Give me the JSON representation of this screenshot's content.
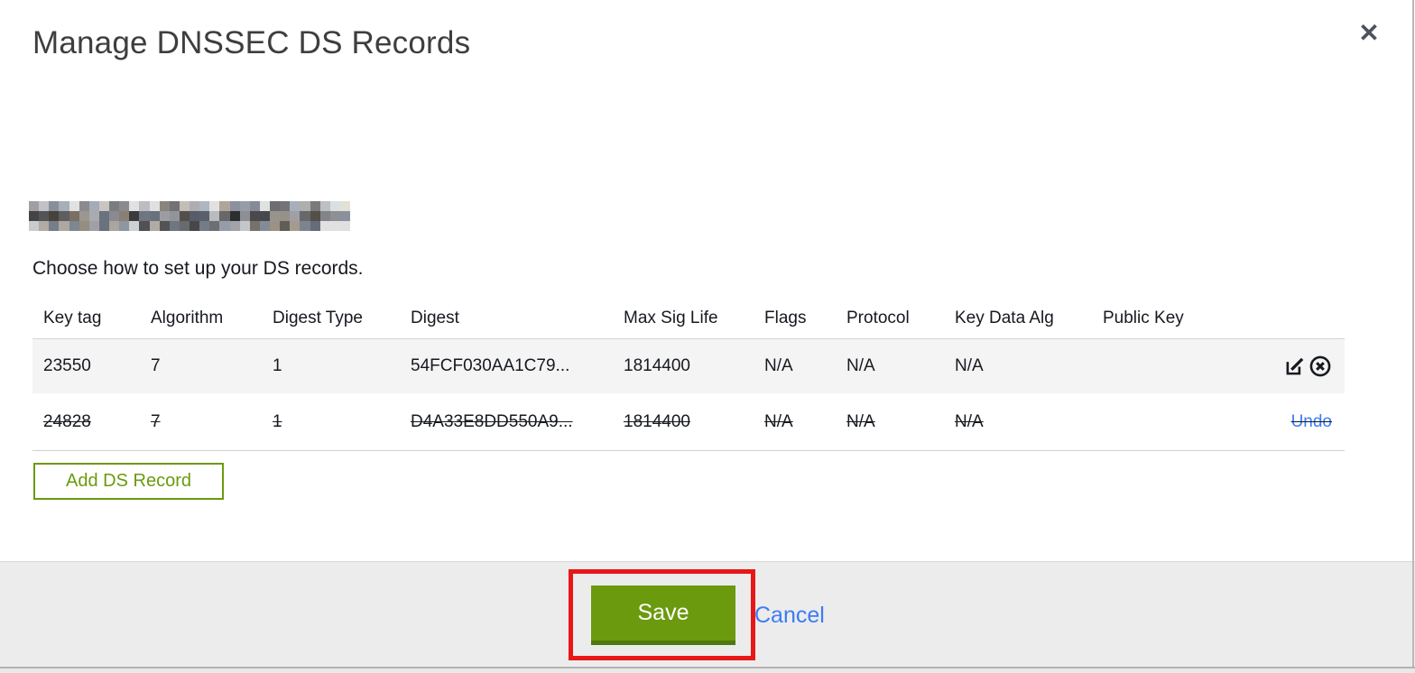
{
  "dialog": {
    "title": "Manage DNSSEC DS Records",
    "subtitle": "Choose how to set up your DS records.",
    "domain_redacted": true
  },
  "icons": {
    "close": "✕",
    "row_actions": [
      "edit-icon",
      "delete-circle-x-icon"
    ]
  },
  "table": {
    "columns": [
      "Key tag",
      "Algorithm",
      "Digest Type",
      "Digest",
      "Max Sig Life",
      "Flags",
      "Protocol",
      "Key Data Alg",
      "Public Key"
    ],
    "rows": [
      {
        "key_tag": "23550",
        "algorithm": "7",
        "digest_type": "1",
        "digest": "54FCF030AA1C79...",
        "max_sig_life": "1814400",
        "flags": "N/A",
        "protocol": "N/A",
        "key_data_alg": "N/A",
        "public_key": "",
        "state": "normal"
      },
      {
        "key_tag": "24828",
        "algorithm": "7",
        "digest_type": "1",
        "digest": "D4A33E8DD550A9...",
        "max_sig_life": "1814400",
        "flags": "N/A",
        "protocol": "N/A",
        "key_data_alg": "N/A",
        "public_key": "",
        "state": "marked-for-deletion",
        "action_label": "Undo"
      }
    ]
  },
  "buttons": {
    "add_ds_record": "Add DS Record",
    "save": "Save",
    "cancel": "Cancel"
  },
  "annotation": {
    "type": "highlight-rectangle",
    "target": "save-button",
    "color": "#e81717"
  },
  "colors": {
    "green": "#6b9a0e",
    "green_dark": "#4f790d",
    "link_blue": "#3b7cf6",
    "row_alt_bg": "#f4f4f4",
    "footer_bg": "#ececec",
    "text": "#16191f"
  }
}
